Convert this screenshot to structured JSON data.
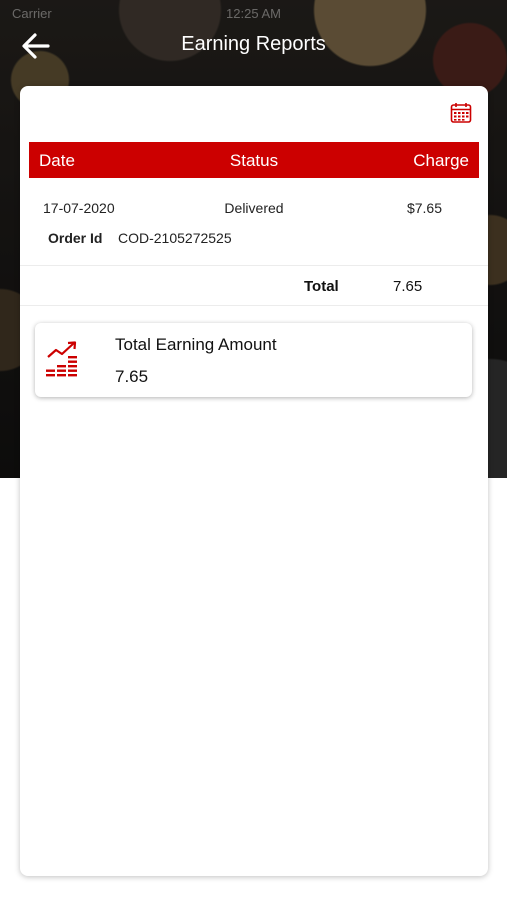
{
  "status_bar": {
    "carrier": "Carrier",
    "time": "12:25 AM",
    "battery": ""
  },
  "header": {
    "title": "Earning Reports",
    "back_icon": "back-arrow-icon"
  },
  "toolbar": {
    "calendar_icon": "calendar-icon"
  },
  "table": {
    "columns": [
      "Date",
      "Status",
      "Charge"
    ],
    "rows": [
      {
        "date": "17-07-2020",
        "status": "Delivered",
        "charge": "$7.65",
        "order_id_label": "Order Id",
        "order_id": "COD-2105272525"
      }
    ],
    "total_label": "Total",
    "total_value": "7.65"
  },
  "summary": {
    "icon": "earnings-chart-icon",
    "title": "Total Earning Amount",
    "value": "7.65"
  },
  "colors": {
    "accent": "#cc0000",
    "header_text": "#ffffff"
  }
}
